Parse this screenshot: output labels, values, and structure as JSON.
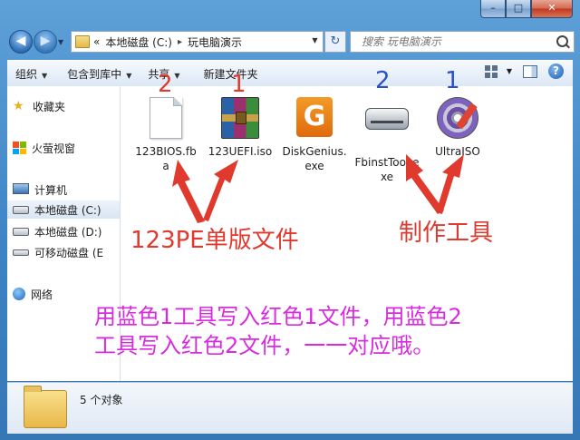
{
  "window": {
    "caption_buttons": {
      "minimize": "–",
      "maximize": "□",
      "close": "✕"
    }
  },
  "nav": {
    "back_glyph": "◀",
    "forward_glyph": "▶",
    "dropdown_glyph": "▼",
    "address": {
      "prefix": "«",
      "parts": [
        "本地磁盘 (C:)",
        "玩电脑演示"
      ],
      "separator": "▸"
    },
    "refresh_glyph": "↻",
    "search_placeholder": "搜索 玩电脑演示"
  },
  "toolbar": {
    "organize": "组织",
    "include_in_library": "包含到库中",
    "share": "共享",
    "new_folder": "新建文件夹",
    "help": "?"
  },
  "sidebar": {
    "favorites": "收藏夹",
    "firefly": "火萤视窗",
    "computer": "计算机",
    "drive_c": "本地磁盘 (C:)",
    "drive_d": "本地磁盘 (D:)",
    "removable": "可移动磁盘 (E",
    "network": "网络"
  },
  "files": [
    {
      "name": "123BIOS.fba",
      "icon": "document-icon"
    },
    {
      "name": "123UEFI.iso",
      "icon": "winrar-archive-icon"
    },
    {
      "name": "DiskGenius.exe",
      "icon": "diskgenius-icon"
    },
    {
      "name": "FbinstTool.exe",
      "icon": "hard-drive-icon"
    },
    {
      "name": "UltraISO",
      "icon": "ultraiso-disc-icon"
    }
  ],
  "annotations": {
    "num_red_2": "2",
    "num_red_1": "1",
    "num_blue_2": "2",
    "num_blue_1": "1",
    "pe_files": "123PE单版文件",
    "tools": "制作工具",
    "note_line1": "用蓝色1工具写入红色1文件，用蓝色2",
    "note_line2": "工具写入红色2文件，一一对应哦。",
    "colors": {
      "red": "#e03a2f",
      "blue": "#2a4fc7",
      "pink": "#d82be0"
    }
  },
  "status": {
    "object_count": "5 个对象"
  }
}
